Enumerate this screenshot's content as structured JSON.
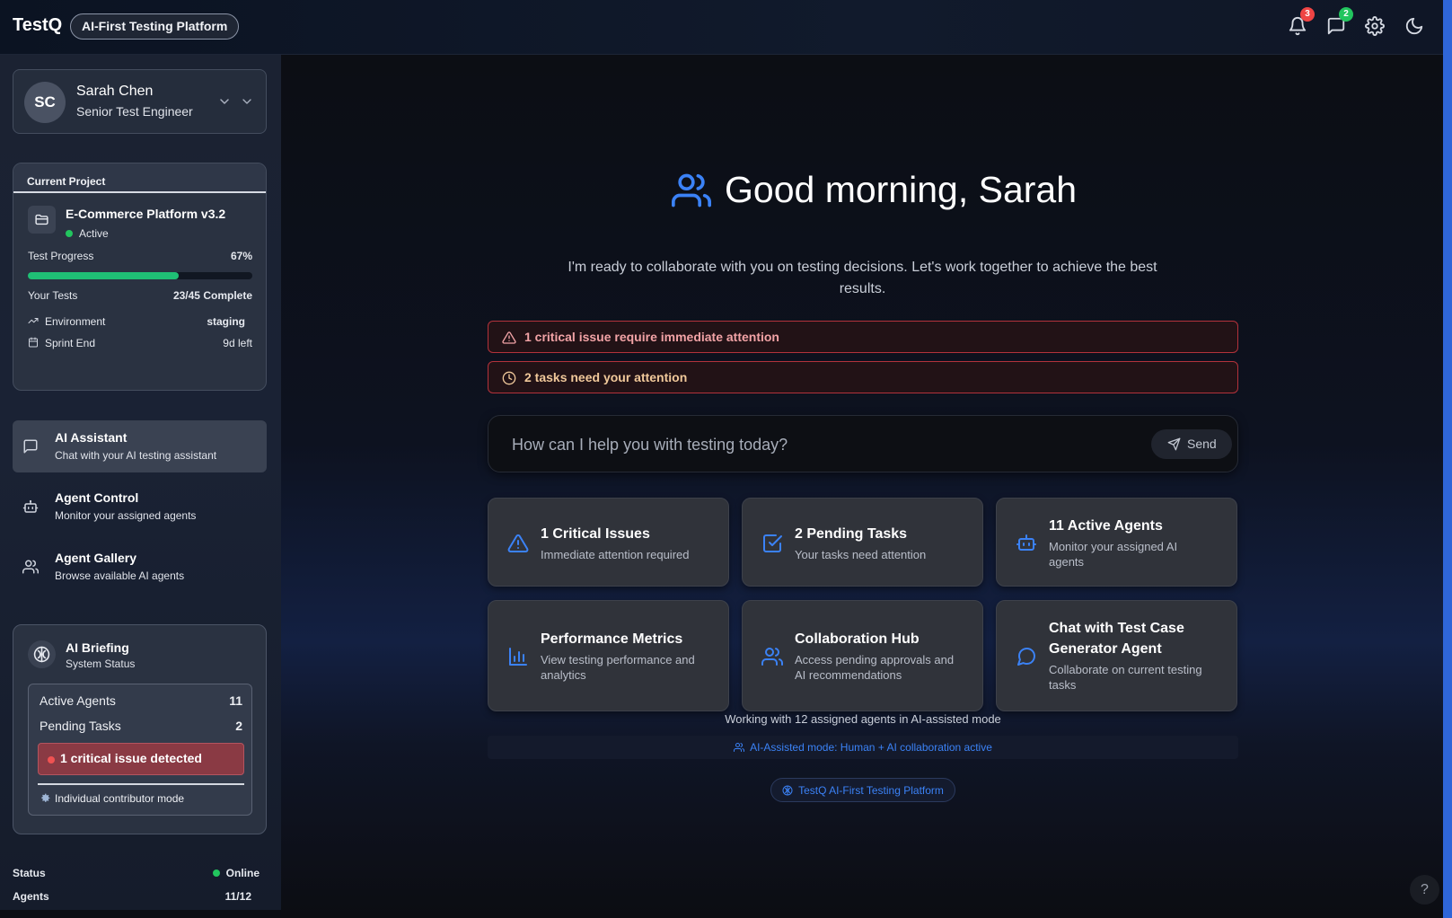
{
  "header": {
    "brand": "TestQ",
    "tagline": "AI-First Testing Platform",
    "notifications_count": "3",
    "messages_count": "2",
    "icons": [
      "bell-icon",
      "message-icon",
      "gear-icon",
      "moon-icon"
    ]
  },
  "user": {
    "initials": "SC",
    "name": "Sarah Chen",
    "role": "Senior Test Engineer"
  },
  "project": {
    "header": "Current Project",
    "name": "E-Commerce Platform v3.2",
    "status": "Active",
    "progress_label": "Test Progress",
    "progress_value": "67%",
    "progress_fraction": 0.67,
    "tests_label": "Your Tests",
    "tests_value": "23/45 Complete",
    "env_label": "Environment",
    "env_value": "staging",
    "sprint_label": "Sprint End",
    "sprint_value": "9d left"
  },
  "nav": [
    {
      "title": "AI Assistant",
      "subtitle": "Chat with your AI testing assistant"
    },
    {
      "title": "Agent Control",
      "subtitle": "Monitor your assigned agents"
    },
    {
      "title": "Agent Gallery",
      "subtitle": "Browse available AI agents"
    }
  ],
  "briefing": {
    "title": "AI Briefing",
    "subtitle": "System Status",
    "active_agents_label": "Active Agents",
    "active_agents_value": "11",
    "pending_tasks_label": "Pending Tasks",
    "pending_tasks_value": "2",
    "critical_text": "1 critical issue detected",
    "mode_text": "Individual contributor mode"
  },
  "sidebar_footer": {
    "status_label": "Status",
    "status_value": "Online",
    "agents_label": "Agents",
    "agents_value": "11/12"
  },
  "main": {
    "greeting": "Good morning, Sarah",
    "intro": "I'm ready to collaborate with you on testing decisions. Let's work together to achieve the best results.",
    "alert_critical": "1 critical issue require immediate attention",
    "alert_tasks": "2 tasks need your attention",
    "chat_placeholder": "How can I help you with testing today?",
    "send_label": "Send",
    "cards": [
      {
        "title": "1 Critical Issues",
        "desc": "Immediate attention required",
        "icon": "alert-triangle-icon"
      },
      {
        "title": "2 Pending Tasks",
        "desc": "Your tasks need attention",
        "icon": "check-square-icon"
      },
      {
        "title": "11 Active Agents",
        "desc": "Monitor your assigned AI agents",
        "icon": "bot-icon"
      },
      {
        "title": "Performance Metrics",
        "desc": "View testing performance and analytics",
        "icon": "bar-chart-icon"
      },
      {
        "title": "Collaboration Hub",
        "desc": "Access pending approvals and AI recommendations",
        "icon": "users-icon"
      },
      {
        "title": "Chat with Test Case Generator Agent",
        "desc": "Collaborate on current testing tasks",
        "icon": "chat-icon"
      }
    ],
    "working_text": "Working with 12 assigned agents in AI-assisted mode",
    "mode_text": "AI-Assisted mode: Human + AI collaboration active",
    "footer_text": "TestQ AI-First Testing Platform",
    "help": "?"
  },
  "colors": {
    "accent": "#3b82f6",
    "success": "#22c55e",
    "danger": "#ef4444",
    "alert_text_critical": "#f2a3a6",
    "alert_text_tasks": "#f0c89a"
  }
}
